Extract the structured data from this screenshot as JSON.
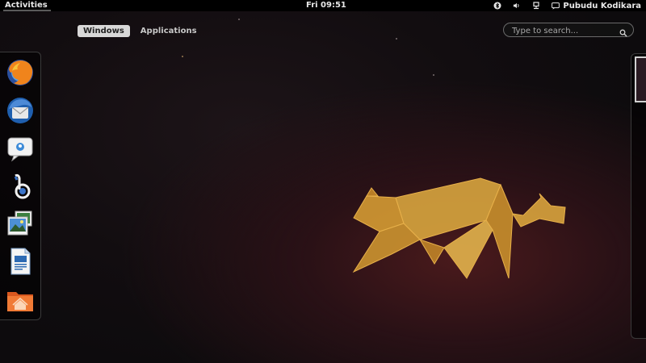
{
  "topbar": {
    "activities": "Activities",
    "clock": "Fri 09:51",
    "icons": [
      "bluetooth-icon",
      "volume-icon",
      "network-icon",
      "user-icon"
    ],
    "username": "Pubudu Kodikara"
  },
  "overview": {
    "tabs": [
      {
        "label": "Windows",
        "active": true
      },
      {
        "label": "Applications",
        "active": false
      }
    ]
  },
  "search": {
    "placeholder": "Type to search..."
  },
  "dash": {
    "apps": [
      "firefox-icon",
      "thunderbird-icon",
      "empathy-icon",
      "banshee-icon",
      "shotwell-icon",
      "libreoffice-writer-icon",
      "home-folder-icon"
    ]
  },
  "colors": {
    "topbar_bg": "#000000",
    "accent": "#d8d8d8",
    "cat": "#d8a23a"
  }
}
